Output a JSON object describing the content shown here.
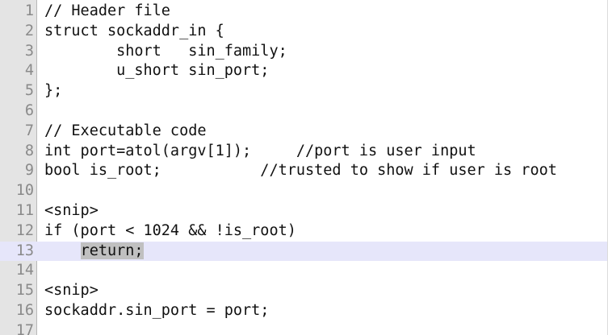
{
  "editor": {
    "current_line": 13,
    "lines": [
      {
        "num": "1",
        "text": "// Header file"
      },
      {
        "num": "2",
        "text": "struct sockaddr_in {"
      },
      {
        "num": "3",
        "text": "        short   sin_family;"
      },
      {
        "num": "4",
        "text": "        u_short sin_port;"
      },
      {
        "num": "5",
        "text": "};"
      },
      {
        "num": "6",
        "text": ""
      },
      {
        "num": "7",
        "text": "// Executable code"
      },
      {
        "num": "8",
        "text": "int port=atol(argv[1]);     //port is user input"
      },
      {
        "num": "9",
        "text": "bool is_root;           //trusted to show if user is root"
      },
      {
        "num": "10",
        "text": ""
      },
      {
        "num": "11",
        "text": "<snip>"
      },
      {
        "num": "12",
        "text": "if (port < 1024 && !is_root)"
      },
      {
        "num": "13",
        "text": "    ",
        "selected": "return;"
      },
      {
        "num": "14",
        "text": ""
      },
      {
        "num": "15",
        "text": "<snip>"
      },
      {
        "num": "16",
        "text": "sockaddr.sin_port = port;"
      },
      {
        "num": "17",
        "text": ""
      }
    ]
  },
  "colors": {
    "gutter_bg": "#e4e4e4",
    "line_number": "#8a8a8a",
    "current_line_bg": "#e6e6fa",
    "selection_bg": "#c0c0c0",
    "text": "#111111"
  }
}
